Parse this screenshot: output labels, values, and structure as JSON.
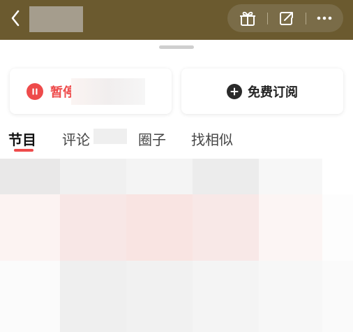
{
  "header": {
    "back_icon": "chevron-left-icon",
    "actions": [
      {
        "name": "gift",
        "icon": "gift-icon"
      },
      {
        "name": "share",
        "icon": "share-icon"
      },
      {
        "name": "more",
        "icon": "more-dots-icon"
      }
    ]
  },
  "controls": {
    "pause_label": "暂停",
    "pause_icon": "pause-circle-icon",
    "subscribe_label": "免费订阅",
    "subscribe_icon": "plus-circle-icon"
  },
  "tabs": [
    {
      "label": "节目",
      "active": true
    },
    {
      "label": "评论",
      "active": false
    },
    {
      "label": "圈子",
      "active": false
    },
    {
      "label": "找相似",
      "active": false
    }
  ],
  "colors": {
    "header_bg": "#6b5a2f",
    "accent": "#ee4b4b",
    "text_dark": "#222222"
  },
  "content_grid": [
    [
      "#e9e8e8",
      "#f0f0f0",
      "#f4f4f4",
      "#ececec",
      "#f7f7f7",
      "#ffffff"
    ],
    [
      "#fcf3f2",
      "#f8e7e6",
      "#f9e4e2",
      "#f8e8e7",
      "#fcf5f4",
      "#fdfdfd"
    ],
    [
      "#fbfbfb",
      "#efefef",
      "#f1f1f1",
      "#f4f4f4",
      "#f7f7f7",
      "#fafafa"
    ]
  ]
}
